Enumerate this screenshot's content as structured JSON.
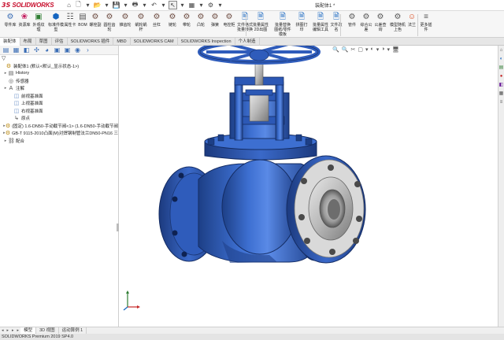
{
  "titlebar": {
    "brand": "SOLIDWORKS",
    "brand_prefix": "3S",
    "title": "装配体1 *",
    "quick_access": [
      "⌂",
      "🗋",
      "▾",
      "📂",
      "▾",
      "💾",
      "▾",
      "🖶",
      "▾",
      "↶",
      "▾",
      "↖",
      "▾",
      "▦",
      "▾",
      "⚙",
      "▾"
    ]
  },
  "ribbon": {
    "buttons": [
      {
        "icon": "⚙",
        "label": "零件库",
        "color": "#3a6db5"
      },
      {
        "icon": "❀",
        "label": "资源库",
        "color": "#c2185b"
      },
      {
        "icon": "▣",
        "label": "外观纹理",
        "color": "#2e7d32"
      },
      {
        "icon": "⬢",
        "label": "标准件模型",
        "color": "#1565c0"
      },
      {
        "icon": "☷",
        "label": "属性卡",
        "color": "#555"
      },
      {
        "icon": "▤",
        "label": "BOM",
        "color": "#555"
      },
      {
        "icon": "⚙",
        "label": "螺栓副",
        "color": "#6d4c41"
      },
      {
        "icon": "⚙",
        "label": "圆柱齿轮",
        "color": "#6d4c41"
      },
      {
        "icon": "⚙",
        "label": "锥齿轮",
        "color": "#6d4c41"
      },
      {
        "icon": "⚙",
        "label": "蜗轮蜗杆",
        "color": "#6d4c41"
      },
      {
        "icon": "⚙",
        "label": "丝杠",
        "color": "#6d4c41"
      },
      {
        "icon": "⚙",
        "label": "链轮",
        "color": "#6d4c41"
      },
      {
        "icon": "⚙",
        "label": "带轮",
        "color": "#6d4c41"
      },
      {
        "icon": "⚙",
        "label": "凸轮",
        "color": "#6d4c41"
      },
      {
        "icon": "⚙",
        "label": "弹簧",
        "color": "#6d4c41"
      },
      {
        "icon": "⚙",
        "label": "电控柜",
        "color": "#6d4c41"
      },
      {
        "icon": "🗎",
        "label": "文件格式批量转换",
        "color": "#1565c0"
      },
      {
        "icon": "🗎",
        "label": "批量属性2D出图",
        "color": "#1565c0"
      },
      {
        "icon": "🗎",
        "label": "批量替换图纸/零件模板",
        "color": "#1565c0"
      },
      {
        "icon": "🗎",
        "label": "拼图打印",
        "color": "#1565c0"
      },
      {
        "icon": "🗎",
        "label": "批量属性编辑工具",
        "color": "#1565c0"
      },
      {
        "icon": "🗎",
        "label": "文件改名",
        "color": "#1565c0"
      },
      {
        "icon": "⚙",
        "label": "管件",
        "color": "#555"
      },
      {
        "icon": "⚙",
        "label": "综合公差",
        "color": "#555"
      },
      {
        "icon": "⚙",
        "label": "公差查询",
        "color": "#555"
      },
      {
        "icon": "⚙",
        "label": "模型随机上色",
        "color": "#555"
      },
      {
        "icon": "☺",
        "label": "法兰",
        "color": "#d84315"
      },
      {
        "icon": "≡",
        "label": "更多插件",
        "color": "#555"
      }
    ]
  },
  "tabs": [
    "装配体",
    "布局",
    "草图",
    "评估",
    "SOLIDWORKS 插件",
    "MBD",
    "SOLIDWORKS CAM",
    "SOLIDWORKS Inspection",
    "个人制造"
  ],
  "active_tab": "装配体",
  "feature_manager": {
    "filter_symbol": "▽",
    "nodes": [
      {
        "level": 0,
        "arrow": "",
        "icon": "⚙",
        "label": "装配体1 (默认<默认_显示状态-1>)"
      },
      {
        "level": 1,
        "arrow": "▸",
        "icon": "▤",
        "label": "History"
      },
      {
        "level": 1,
        "arrow": "",
        "icon": "◎",
        "label": "传感器"
      },
      {
        "level": 1,
        "arrow": "▸",
        "icon": "A",
        "label": "注解"
      },
      {
        "level": 2,
        "arrow": "",
        "icon": "◫",
        "label": "前视基准面"
      },
      {
        "level": 2,
        "arrow": "",
        "icon": "◫",
        "label": "上视基准面"
      },
      {
        "level": 2,
        "arrow": "",
        "icon": "◫",
        "label": "右视基准面"
      },
      {
        "level": 2,
        "arrow": "",
        "icon": "↳",
        "label": "原点"
      },
      {
        "level": 1,
        "arrow": "▸",
        "icon": "⚙",
        "label": "(固定) 1.6-DN50-手动截节阀<1> (1.6-DN50-手动截节阀"
      },
      {
        "level": 1,
        "arrow": "▸",
        "icon": "⚙",
        "label": "GB-T 9115-2010凸面(M)对焊钢制管法兰DN50-PN16 三"
      },
      {
        "level": 1,
        "arrow": "▸",
        "icon": "⛓",
        "label": "配合"
      }
    ]
  },
  "viewport": {
    "hud_icons": [
      "🔍",
      "🔍",
      "✂",
      "▢",
      "▾",
      "◐",
      "▾",
      "◑",
      "▾",
      "🖥"
    ]
  },
  "taskpane": [
    "⌂",
    "◐",
    "▤",
    "●",
    "◧",
    "▦",
    "≡"
  ],
  "bottom_tabs": [
    "模型",
    "3D 视图",
    "运动算例 1"
  ],
  "active_bottom_tab": "模型",
  "status": {
    "text": "SOLIDWORKS Premium 2019 SP4.0"
  }
}
